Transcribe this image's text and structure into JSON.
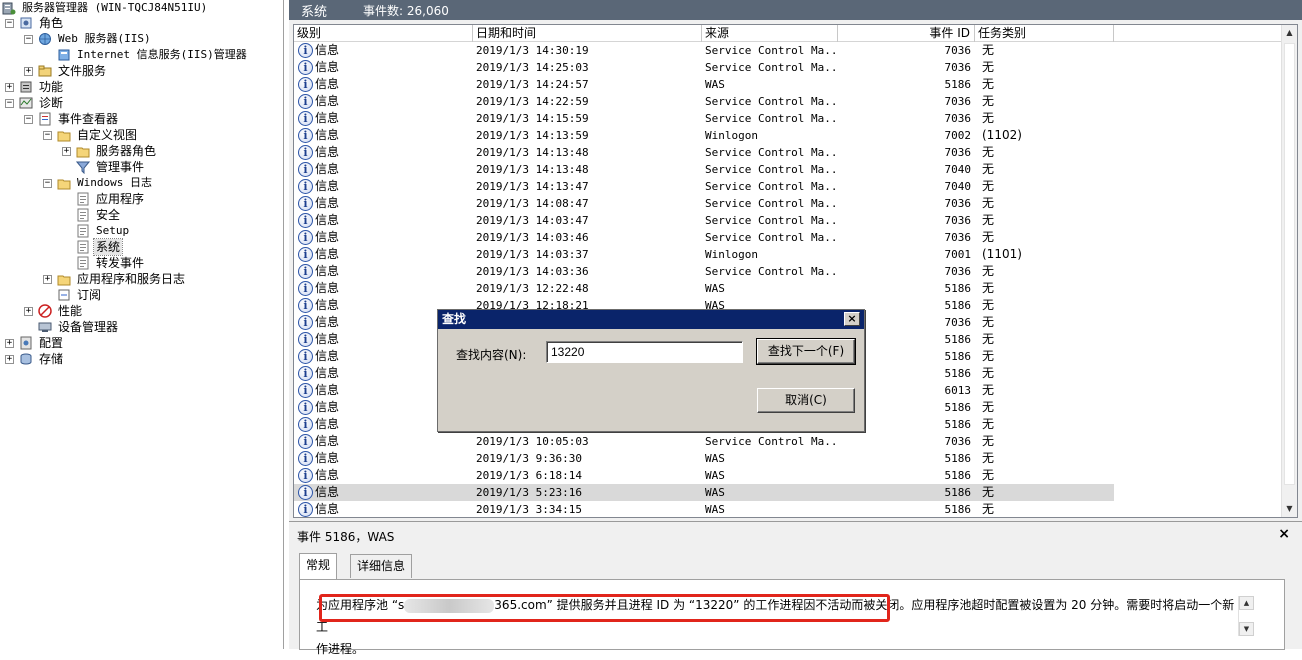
{
  "tree": {
    "root": "服务器管理器 (WIN-TQCJ84N51IU)",
    "items": [
      {
        "label": "角色",
        "level": 0,
        "expander": "−",
        "icon": "roles-icon"
      },
      {
        "label": "Web 服务器(IIS)",
        "level": 1,
        "expander": "−",
        "icon": "web-server-icon"
      },
      {
        "label": "Internet 信息服务(IIS)管理器",
        "level": 2,
        "expander": "",
        "icon": "iis-manager-icon"
      },
      {
        "label": "文件服务",
        "level": 1,
        "expander": "+",
        "icon": "file-services-icon"
      },
      {
        "label": "功能",
        "level": 0,
        "expander": "+",
        "icon": "features-icon"
      },
      {
        "label": "诊断",
        "level": 0,
        "expander": "−",
        "icon": "diagnostics-icon"
      },
      {
        "label": "事件查看器",
        "level": 1,
        "expander": "−",
        "icon": "event-viewer-icon"
      },
      {
        "label": "自定义视图",
        "level": 2,
        "expander": "−",
        "icon": "folder-icon"
      },
      {
        "label": "服务器角色",
        "level": 3,
        "expander": "+",
        "icon": "folder-icon"
      },
      {
        "label": "管理事件",
        "level": 3,
        "expander": "",
        "icon": "filter-icon"
      },
      {
        "label": "Windows 日志",
        "level": 2,
        "expander": "−",
        "icon": "folder-icon"
      },
      {
        "label": "应用程序",
        "level": 3,
        "expander": "",
        "icon": "log-icon"
      },
      {
        "label": "安全",
        "level": 3,
        "expander": "",
        "icon": "log-icon"
      },
      {
        "label": "Setup",
        "level": 3,
        "expander": "",
        "icon": "log-icon"
      },
      {
        "label": "系统",
        "level": 3,
        "expander": "",
        "icon": "log-icon",
        "selected": true
      },
      {
        "label": "转发事件",
        "level": 3,
        "expander": "",
        "icon": "log-icon"
      },
      {
        "label": "应用程序和服务日志",
        "level": 2,
        "expander": "+",
        "icon": "folder-icon"
      },
      {
        "label": "订阅",
        "level": 2,
        "expander": "",
        "icon": "subscriptions-icon"
      },
      {
        "label": "性能",
        "level": 1,
        "expander": "+",
        "icon": "performance-icon"
      },
      {
        "label": "设备管理器",
        "level": 1,
        "expander": "",
        "icon": "device-manager-icon"
      },
      {
        "label": "配置",
        "level": 0,
        "expander": "+",
        "icon": "configuration-icon"
      },
      {
        "label": "存储",
        "level": 0,
        "expander": "+",
        "icon": "storage-icon"
      }
    ]
  },
  "header": {
    "title": "系统",
    "count": "事件数: 26,060"
  },
  "columns": {
    "level": "级别",
    "datetime": "日期和时间",
    "source": "来源",
    "event_id": "事件 ID",
    "task": "任务类别"
  },
  "events": [
    {
      "level": "信息",
      "datetime": "2019/1/3 14:30:19",
      "source": "Service Control Ma...",
      "event_id": "7036",
      "task": "无"
    },
    {
      "level": "信息",
      "datetime": "2019/1/3 14:25:03",
      "source": "Service Control Ma...",
      "event_id": "7036",
      "task": "无"
    },
    {
      "level": "信息",
      "datetime": "2019/1/3 14:24:57",
      "source": "WAS",
      "event_id": "5186",
      "task": "无"
    },
    {
      "level": "信息",
      "datetime": "2019/1/3 14:22:59",
      "source": "Service Control Ma...",
      "event_id": "7036",
      "task": "无"
    },
    {
      "level": "信息",
      "datetime": "2019/1/3 14:15:59",
      "source": "Service Control Ma...",
      "event_id": "7036",
      "task": "无"
    },
    {
      "level": "信息",
      "datetime": "2019/1/3 14:13:59",
      "source": "Winlogon",
      "event_id": "7002",
      "task": "(1102)"
    },
    {
      "level": "信息",
      "datetime": "2019/1/3 14:13:48",
      "source": "Service Control Ma...",
      "event_id": "7036",
      "task": "无"
    },
    {
      "level": "信息",
      "datetime": "2019/1/3 14:13:48",
      "source": "Service Control Ma...",
      "event_id": "7040",
      "task": "无"
    },
    {
      "level": "信息",
      "datetime": "2019/1/3 14:13:47",
      "source": "Service Control Ma...",
      "event_id": "7040",
      "task": "无"
    },
    {
      "level": "信息",
      "datetime": "2019/1/3 14:08:47",
      "source": "Service Control Ma...",
      "event_id": "7036",
      "task": "无"
    },
    {
      "level": "信息",
      "datetime": "2019/1/3 14:03:47",
      "source": "Service Control Ma...",
      "event_id": "7036",
      "task": "无"
    },
    {
      "level": "信息",
      "datetime": "2019/1/3 14:03:46",
      "source": "Service Control Ma...",
      "event_id": "7036",
      "task": "无"
    },
    {
      "level": "信息",
      "datetime": "2019/1/3 14:03:37",
      "source": "Winlogon",
      "event_id": "7001",
      "task": "(1101)"
    },
    {
      "level": "信息",
      "datetime": "2019/1/3 14:03:36",
      "source": "Service Control Ma...",
      "event_id": "7036",
      "task": "无"
    },
    {
      "level": "信息",
      "datetime": "2019/1/3 12:22:48",
      "source": "WAS",
      "event_id": "5186",
      "task": "无"
    },
    {
      "level": "信息",
      "datetime": "2019/1/3 12:18:21",
      "source": "WAS",
      "event_id": "5186",
      "task": "无"
    },
    {
      "level": "信息",
      "datetime": "",
      "source": "",
      "event_id": "7036",
      "task": "无"
    },
    {
      "level": "信息",
      "datetime": "",
      "source": "",
      "event_id": "5186",
      "task": "无"
    },
    {
      "level": "信息",
      "datetime": "",
      "source": "",
      "event_id": "5186",
      "task": "无"
    },
    {
      "level": "信息",
      "datetime": "",
      "source": "",
      "event_id": "5186",
      "task": "无"
    },
    {
      "level": "信息",
      "datetime": "",
      "source": "",
      "event_id": "6013",
      "task": "无"
    },
    {
      "level": "信息",
      "datetime": "",
      "source": "",
      "event_id": "5186",
      "task": "无"
    },
    {
      "level": "信息",
      "datetime": "",
      "source": "",
      "event_id": "5186",
      "task": "无"
    },
    {
      "level": "信息",
      "datetime": "2019/1/3 10:05:03",
      "source": "Service Control Ma...",
      "event_id": "7036",
      "task": "无"
    },
    {
      "level": "信息",
      "datetime": "2019/1/3 9:36:30",
      "source": "WAS",
      "event_id": "5186",
      "task": "无"
    },
    {
      "level": "信息",
      "datetime": "2019/1/3 6:18:14",
      "source": "WAS",
      "event_id": "5186",
      "task": "无"
    },
    {
      "level": "信息",
      "datetime": "2019/1/3 5:23:16",
      "source": "WAS",
      "event_id": "5186",
      "task": "无",
      "selected": true
    },
    {
      "level": "信息",
      "datetime": "2019/1/3 3:34:15",
      "source": "WAS",
      "event_id": "5186",
      "task": "无"
    }
  ],
  "detail": {
    "title": "事件 5186，WAS",
    "close": "×",
    "tabs": [
      "常规",
      "详细信息"
    ],
    "desc_part1": "为应用程序池 “s",
    "desc_part2": "365.com” 提供服务并且进程 ID 为 “13220” 的工作进程因不活动而被关闭。应用程序池超时配置被设置为 20 分钟。需要时将启动一个新工",
    "desc_line2": "作进程。"
  },
  "find_dialog": {
    "title": "查找",
    "label": "查找内容(N):",
    "value": "13220",
    "find_next": "查找下一个(F)",
    "cancel": "取消(C)",
    "close": "×"
  },
  "colors": {
    "header_bg": "#5a6777",
    "dialog_title_bg": "#0a246a",
    "highlight_box": "#e1251b",
    "selected_row": "#d9d9d9"
  }
}
